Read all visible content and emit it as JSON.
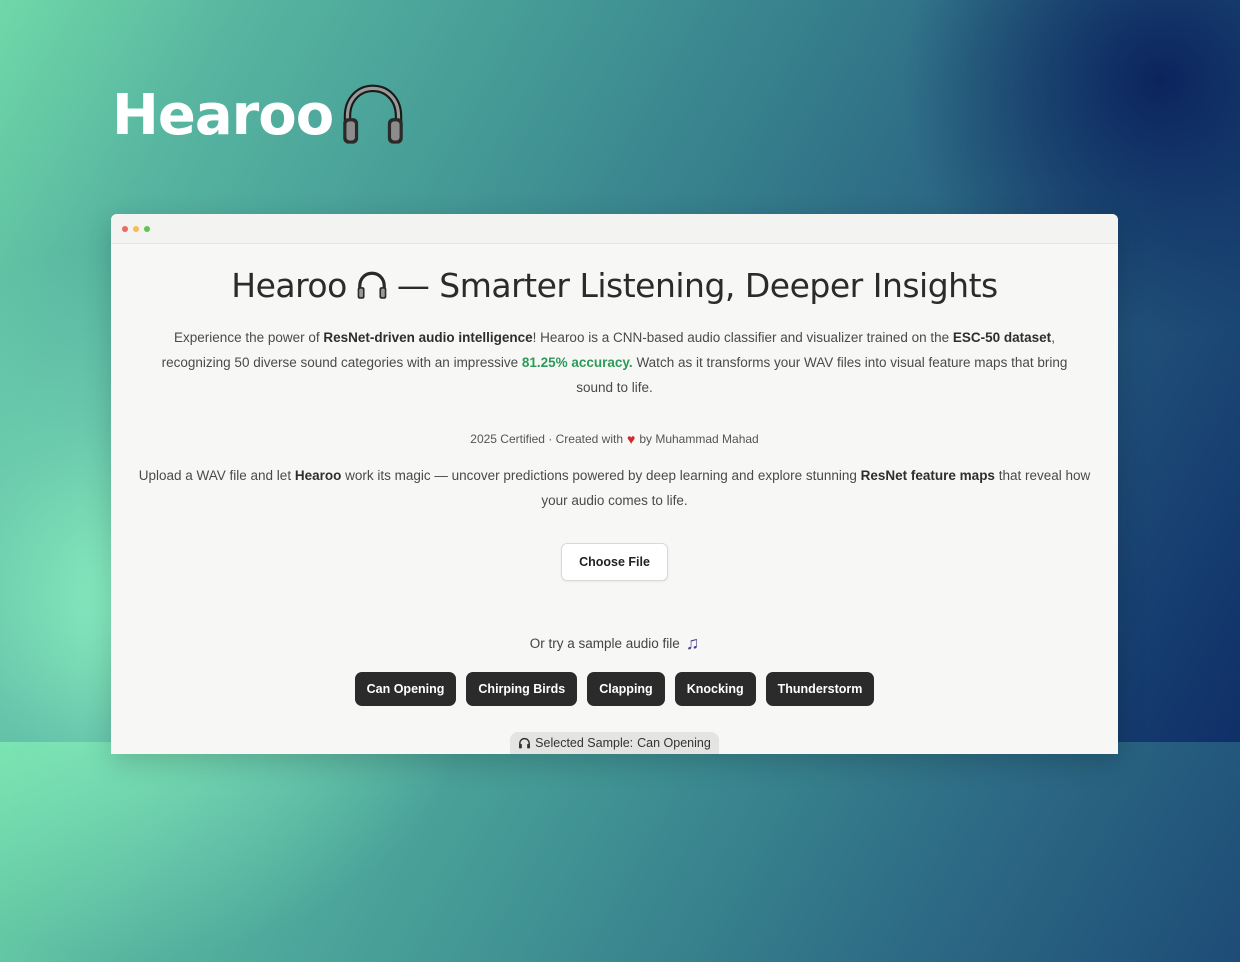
{
  "brand": {
    "name": "Hearoo",
    "icon": "headphones-icon"
  },
  "window": {
    "controls": [
      "close",
      "minimize",
      "maximize"
    ],
    "colors": {
      "close": "#ee6a5f",
      "minimize": "#f5be4f",
      "maximize": "#61c454"
    }
  },
  "page": {
    "title_brand": "Hearoo",
    "title_rest": "— Smarter Listening, Deeper Insights",
    "intro": {
      "p1": "Experience the power of ",
      "b1": "ResNet-driven audio intelligence",
      "p2": "! Hearoo is a CNN-based audio classifier and visualizer trained on the ",
      "b2": "ESC-50 dataset",
      "p3": ", recognizing 50 diverse sound categories with an impressive ",
      "accuracy": "81.25% accuracy.",
      "p4": " Watch as it transforms your WAV files into visual feature maps that bring sound to life."
    },
    "credit": {
      "prefix": "2025 Certified · Created with",
      "heart": "♥",
      "suffix": "by Muhammad Mahad"
    },
    "upload": {
      "p1": "Upload a WAV file and let ",
      "b1": "Hearoo",
      "p2": " work its magic — uncover predictions powered by deep learning and explore stunning ",
      "b2": "ResNet feature maps",
      "p3": " that reveal how your audio comes to life."
    },
    "choose_file_label": "Choose File",
    "sample_prompt": "Or try a sample audio file",
    "sample_icon": "♫",
    "samples": [
      "Can Opening",
      "Chirping Birds",
      "Clapping",
      "Knocking",
      "Thunderstorm"
    ],
    "selected_prefix": "Selected Sample:",
    "selected_value": "Can Opening"
  },
  "colors": {
    "accent_green": "#2c9b57",
    "chip_bg": "#2b2b2b",
    "heart": "#d8282f"
  }
}
